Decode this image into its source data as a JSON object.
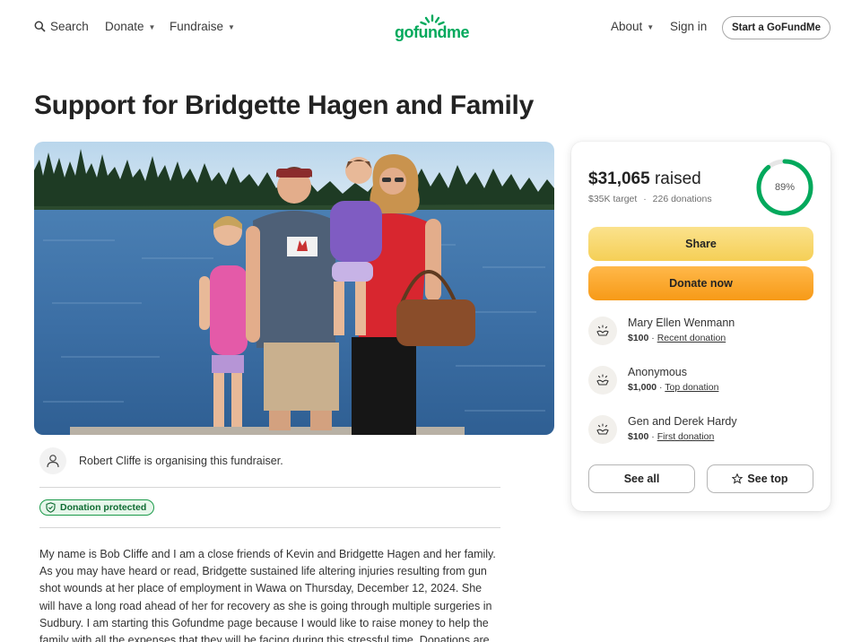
{
  "nav": {
    "search_label": "Search",
    "donate_label": "Donate",
    "fundraise_label": "Fundraise",
    "logo_text": "gofundme",
    "about_label": "About",
    "signin_label": "Sign in",
    "start_label": "Start a GoFundMe"
  },
  "page": {
    "title": "Support for Bridgette Hagen and Family"
  },
  "organiser": {
    "text": "Robert Cliffe is organising this fundraiser."
  },
  "badge": {
    "label": "Donation protected"
  },
  "story": {
    "lines": [
      "My name is Bob Cliffe and I am a close friends of Kevin and Bridgette Hagen and her family.",
      "As you may have heard or read, Bridgette sustained life altering injuries resulting from gun",
      "shot wounds at her place of employment in Wawa on Thursday, December 12, 2024. She",
      "will have a long road ahead of her for recovery as she is going through multiple surgeries in",
      "Sudbury. I am starting this Gofundme page because I would like to raise money to help the",
      "family with all the expenses that they will be facing during this stressful time. Donations are"
    ]
  },
  "progress": {
    "raised_amount": "$31,065",
    "raised_word": "raised",
    "target": "$35K target",
    "separator": "·",
    "donations": "226 donations",
    "percent_label": "89%",
    "percent_value": 89
  },
  "actions": {
    "share_label": "Share",
    "donate_label": "Donate now",
    "see_all_label": "See all",
    "see_top_label": "See top"
  },
  "donations": [
    {
      "name": "Mary Ellen Wenmann",
      "amount": "$100",
      "sep": "·",
      "tag": "Recent donation"
    },
    {
      "name": "Anonymous",
      "amount": "$1,000",
      "sep": "·",
      "tag": "Top donation"
    },
    {
      "name": "Gen and Derek Hardy",
      "amount": "$100",
      "sep": "·",
      "tag": "First donation"
    }
  ],
  "colors": {
    "brand": "#02a95c",
    "share": "#f5cf56",
    "donate": "#f79a17",
    "ring": "#02a95c"
  }
}
